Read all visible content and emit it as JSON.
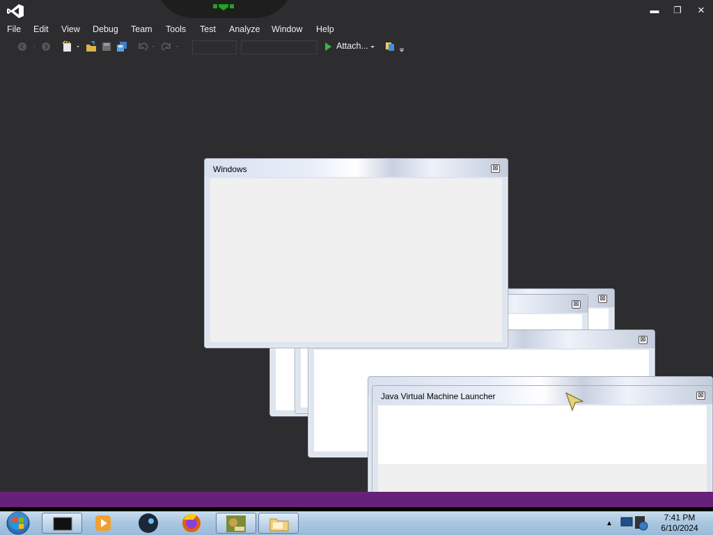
{
  "window_controls": {
    "minimize": "▬",
    "restore": "❐",
    "close": "✕"
  },
  "menu": [
    "File",
    "Edit",
    "View",
    "Debug",
    "Team",
    "Tools",
    "Test",
    "Analyze",
    "Window",
    "Help"
  ],
  "toolbar": {
    "attach_label": "Attach..."
  },
  "dialogs": {
    "windows": {
      "title": "Windows"
    },
    "jvm": {
      "title": "Java Virtual Machine Launcher"
    }
  },
  "taskbar": {
    "time": "7:41 PM",
    "date": "6/10/2024"
  },
  "colors": {
    "ide_background": "#2d2d30",
    "statusbar": "#68217a",
    "accent_green": "#1fa31f"
  }
}
